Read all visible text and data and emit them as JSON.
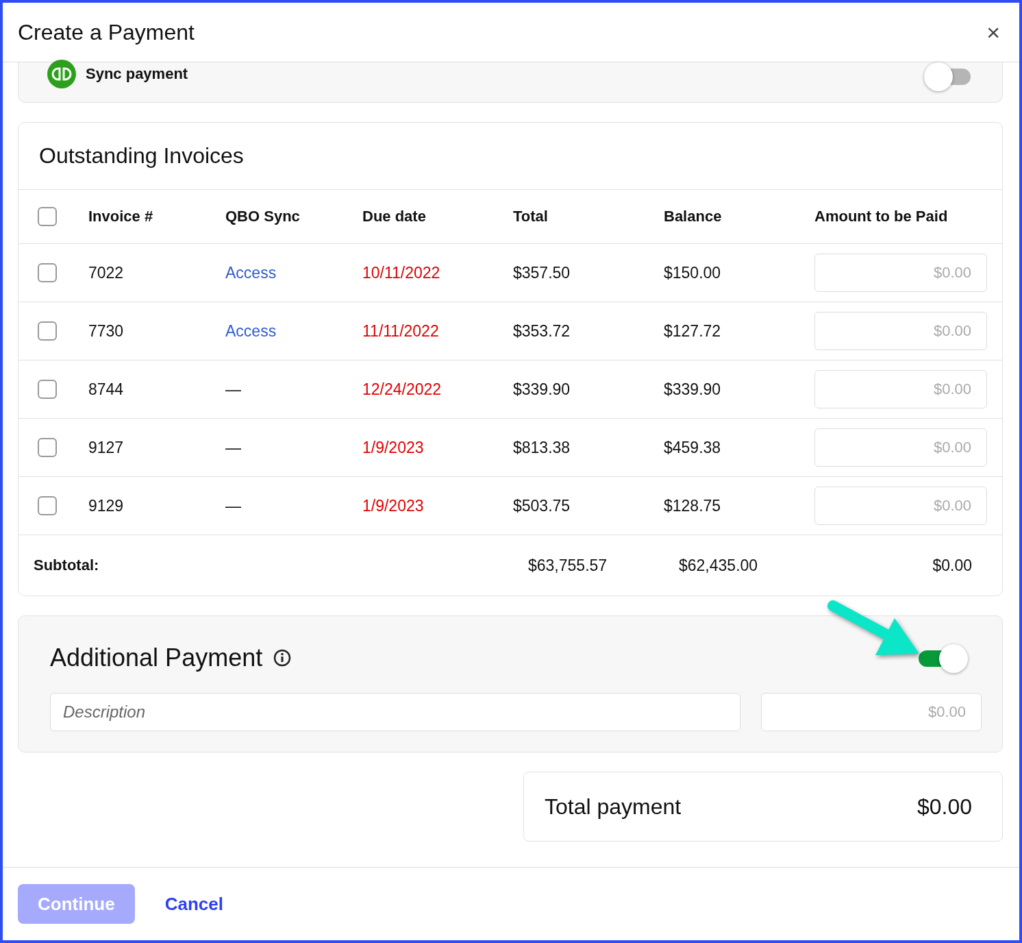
{
  "dialog": {
    "title": "Create a Payment",
    "close": "×"
  },
  "sync": {
    "label": "Sync payment",
    "on": false
  },
  "invoices": {
    "title": "Outstanding Invoices",
    "header_checked": false,
    "columns": [
      "Invoice #",
      "QBO Sync",
      "Due date",
      "Total",
      "Balance",
      "Amount to be Paid"
    ],
    "rows": [
      {
        "checked": false,
        "invoice": "7022",
        "qbo": {
          "kind": "link",
          "text": "Access"
        },
        "due": "10/11/2022",
        "overdue": true,
        "total": "$357.50",
        "balance": "$150.00",
        "amount_placeholder": "$0.00"
      },
      {
        "checked": false,
        "invoice": "7730",
        "qbo": {
          "kind": "link",
          "text": "Access"
        },
        "due": "11/11/2022",
        "overdue": true,
        "total": "$353.72",
        "balance": "$127.72",
        "amount_placeholder": "$0.00"
      },
      {
        "checked": false,
        "invoice": "8744",
        "qbo": {
          "kind": "text",
          "text": "—"
        },
        "due": "12/24/2022",
        "overdue": true,
        "total": "$339.90",
        "balance": "$339.90",
        "amount_placeholder": "$0.00"
      },
      {
        "checked": false,
        "invoice": "9127",
        "qbo": {
          "kind": "text",
          "text": "—"
        },
        "due": "1/9/2023",
        "overdue": true,
        "total": "$813.38",
        "balance": "$459.38",
        "amount_placeholder": "$0.00"
      },
      {
        "checked": false,
        "invoice": "9129",
        "qbo": {
          "kind": "text",
          "text": "—"
        },
        "due": "1/9/2023",
        "overdue": true,
        "total": "$503.75",
        "balance": "$128.75",
        "amount_placeholder": "$0.00"
      }
    ],
    "subtotal": {
      "label": "Subtotal:",
      "total": "$63,755.57",
      "balance": "$62,435.00",
      "amount": "$0.00"
    }
  },
  "additional": {
    "title": "Additional Payment",
    "on": true,
    "description_placeholder": "Description",
    "amount_placeholder": "$0.00"
  },
  "total": {
    "label": "Total payment",
    "value": "$0.00"
  },
  "buttons": [
    {
      "kind": "primary",
      "label": "Continue",
      "disabled": true
    },
    {
      "kind": "link",
      "label": "Cancel",
      "disabled": false
    }
  ]
}
